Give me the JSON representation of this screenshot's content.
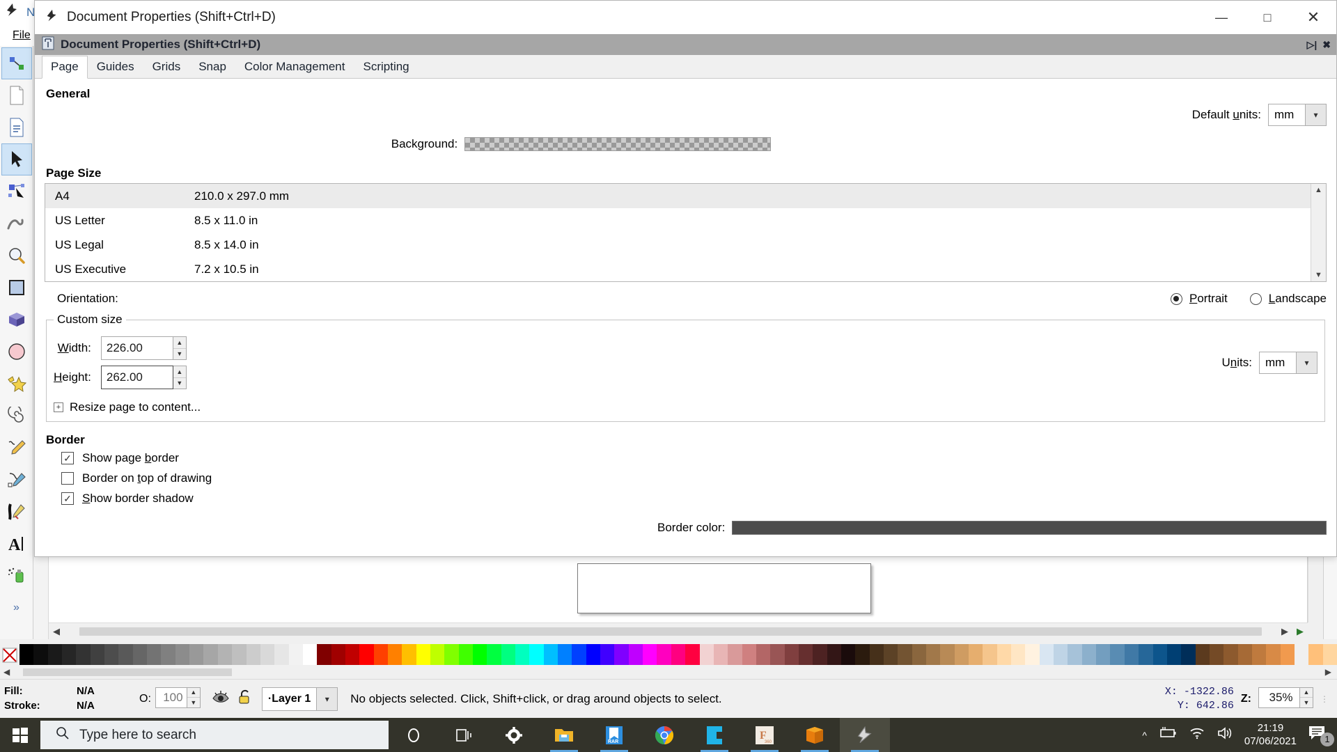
{
  "app": {
    "title": "N",
    "menu": [
      "File"
    ],
    "tool_icons": [
      "node-editor-icon",
      "new-document-icon",
      "document-properties-icon",
      "selector-arrow-icon",
      "node-tool-icon",
      "tweak-tool-icon",
      "zoom-tool-icon",
      "rectangle-tool-icon",
      "box-3d-tool-icon",
      "ellipse-tool-icon",
      "star-tool-icon",
      "spiral-tool-icon",
      "pencil-tool-icon",
      "bezier-tool-icon",
      "calligraphy-tool-icon",
      "text-tool-icon",
      "spray-tool-icon",
      "more-tools-icon"
    ]
  },
  "dialog": {
    "window_title": "Document Properties (Shift+Ctrl+D)",
    "dock_title": "Document Properties (Shift+Ctrl+D)",
    "minimize_icon": "minimize-icon",
    "maximize_icon": "maximize-icon",
    "close_icon": "close-icon",
    "dock_float_icon": "dock-float-icon",
    "dock_close_icon": "dock-close-icon",
    "tabs": [
      {
        "label": "Page",
        "active": true
      },
      {
        "label": "Guides",
        "active": false
      },
      {
        "label": "Grids",
        "active": false
      },
      {
        "label": "Snap",
        "active": false
      },
      {
        "label": "Color Management",
        "active": false
      },
      {
        "label": "Scripting",
        "active": false
      }
    ],
    "general": {
      "heading": "General",
      "default_units_label": "Default units:",
      "default_units_value": "mm",
      "background_label": "Background:",
      "background_swatch": "transparent-checkerboard"
    },
    "page_size": {
      "heading": "Page Size",
      "rows": [
        {
          "name": "A4",
          "dims": "210.0 x 297.0 mm",
          "selected": true
        },
        {
          "name": "US Letter",
          "dims": "8.5 x 11.0 in",
          "selected": false
        },
        {
          "name": "US Legal",
          "dims": "8.5 x 14.0 in",
          "selected": false
        },
        {
          "name": "US Executive",
          "dims": "7.2 x 10.5 in",
          "selected": false
        }
      ]
    },
    "orientation": {
      "label": "Orientation:",
      "portrait_label": "Portrait",
      "landscape_label": "Landscape",
      "selected": "Portrait"
    },
    "custom_size": {
      "legend": "Custom size",
      "width_label": "Width:",
      "width_value": "226.00",
      "height_label": "Height:",
      "height_value": "262.00",
      "units_label": "Units:",
      "units_value": "mm",
      "resize_label": "Resize page to content...",
      "expander_icon": "expander-plus-icon"
    },
    "border": {
      "heading": "Border",
      "items": [
        {
          "label": "Show page border",
          "checked": true
        },
        {
          "label": "Border on top of drawing",
          "checked": false
        },
        {
          "label": "Show border shadow",
          "checked": true
        }
      ],
      "color_label": "Border color:",
      "color_value": "#4d4d4d"
    }
  },
  "statusbar": {
    "fill_label": "Fill:",
    "fill_value": "N/A",
    "stroke_label": "Stroke:",
    "stroke_value": "N/A",
    "opacity_label": "O:",
    "opacity_value": "100",
    "eye_icon": "eye-icon",
    "lock_icon": "unlocked-padlock-icon",
    "layer_value": "Layer 1",
    "message": "No objects selected. Click, Shift+click, or drag around objects to select.",
    "x_label": "X:",
    "x_value": "-1322.86",
    "y_label": "Y:",
    "y_value": "642.86",
    "zoom_label": "Z:",
    "zoom_value": "35%"
  },
  "taskbar": {
    "start_icon": "windows-start-icon",
    "search_icon": "search-icon",
    "search_placeholder": "Type here to search",
    "apps": [
      {
        "name": "cortana-icon",
        "active": false,
        "running": false
      },
      {
        "name": "task-view-icon",
        "active": false,
        "running": false
      },
      {
        "name": "settings-gear-icon",
        "active": false,
        "running": false
      },
      {
        "name": "file-explorer-icon",
        "active": false,
        "running": true
      },
      {
        "name": "winrar-icon",
        "active": false,
        "running": true
      },
      {
        "name": "google-chrome-icon",
        "active": false,
        "running": false
      },
      {
        "name": "camtasia-icon",
        "active": false,
        "running": true
      },
      {
        "name": "fusion360-icon",
        "active": false,
        "running": true
      },
      {
        "name": "blender-icon",
        "active": false,
        "running": true
      },
      {
        "name": "inkscape-icon",
        "active": true,
        "running": true
      }
    ],
    "tray": {
      "chevron_icon": "show-hidden-icons-chevron",
      "battery_icon": "battery-charging-icon",
      "wifi_icon": "wifi-icon",
      "volume_icon": "speaker-icon",
      "time": "21:19",
      "date": "07/06/2021",
      "notification_icon": "action-center-icon",
      "notification_count": "1"
    }
  },
  "palette_colors": [
    "#000000",
    "#0d0d0d",
    "#1a1a1a",
    "#262626",
    "#333333",
    "#404040",
    "#4d4d4d",
    "#595959",
    "#666666",
    "#737373",
    "#808080",
    "#8c8c8c",
    "#999999",
    "#a6a6a6",
    "#b3b3b3",
    "#bfbfbf",
    "#cccccc",
    "#d9d9d9",
    "#e6e6e6",
    "#f2f2f2",
    "#ffffff",
    "#800000",
    "#a00000",
    "#c00000",
    "#ff0000",
    "#ff4000",
    "#ff8000",
    "#ffbf00",
    "#ffff00",
    "#bfff00",
    "#80ff00",
    "#40ff00",
    "#00ff00",
    "#00ff40",
    "#00ff80",
    "#00ffbf",
    "#00ffff",
    "#00bfff",
    "#0080ff",
    "#0040ff",
    "#0000ff",
    "#4000ff",
    "#8000ff",
    "#bf00ff",
    "#ff00ff",
    "#ff00bf",
    "#ff0080",
    "#ff0040",
    "#f2d2d2",
    "#e8b5b5",
    "#d99a9a",
    "#cf8080",
    "#b36666",
    "#995555",
    "#803f3f",
    "#662f2f",
    "#4d2222",
    "#331616",
    "#1a0b0b",
    "#2b1b0e",
    "#46301a",
    "#5c4226",
    "#735432",
    "#8a663e",
    "#a1784a",
    "#b88a56",
    "#cf9c62",
    "#e6ae6e",
    "#f5c58c",
    "#ffd9a8",
    "#ffe6c4",
    "#fff2e0",
    "#d9e6f2",
    "#bfd4e6",
    "#a6c2d9",
    "#8cb0cc",
    "#739ebf",
    "#598cb3",
    "#4079a6",
    "#266799",
    "#0d558c",
    "#003f73",
    "#002e59",
    "#5b3a1e",
    "#744a26",
    "#8d5a2e",
    "#a66a36",
    "#bf7a3e",
    "#d88a46",
    "#f19a4e",
    "#ff aa56",
    "#ffc07a",
    "#ffd6a0"
  ]
}
